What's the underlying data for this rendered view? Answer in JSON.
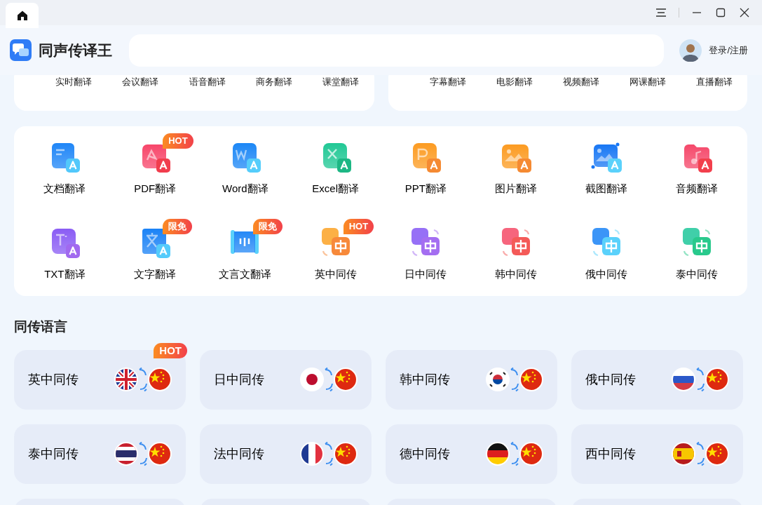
{
  "app": {
    "title": "同声传译王",
    "login": "登录/注册"
  },
  "top_cards": [
    {
      "items": [
        "实时翻译",
        "会议翻译",
        "语音翻译",
        "商务翻译",
        "课堂翻译"
      ]
    },
    {
      "items": [
        "字幕翻译",
        "电影翻译",
        "视频翻译",
        "网课翻译",
        "直播翻译"
      ]
    }
  ],
  "tools": [
    {
      "label": "文档翻译",
      "kind": "doc"
    },
    {
      "label": "PDF翻译",
      "kind": "pdf",
      "badge": "HOT"
    },
    {
      "label": "Word翻译",
      "kind": "word"
    },
    {
      "label": "Excel翻译",
      "kind": "excel"
    },
    {
      "label": "PPT翻译",
      "kind": "ppt"
    },
    {
      "label": "图片翻译",
      "kind": "image"
    },
    {
      "label": "截图翻译",
      "kind": "screenshot"
    },
    {
      "label": "音频翻译",
      "kind": "audio"
    },
    {
      "label": "TXT翻译",
      "kind": "txt"
    },
    {
      "label": "文字翻译",
      "kind": "text",
      "badge": "限免"
    },
    {
      "label": "文言文翻译",
      "kind": "scroll",
      "badge": "限免"
    },
    {
      "label": "英中同传",
      "kind": "pair-orange",
      "badge": "HOT"
    },
    {
      "label": "日中同传",
      "kind": "pair-purple"
    },
    {
      "label": "韩中同传",
      "kind": "pair-red"
    },
    {
      "label": "俄中同传",
      "kind": "pair-blue"
    },
    {
      "label": "泰中同传",
      "kind": "pair-green"
    }
  ],
  "languages": {
    "heading": "同传语言",
    "cards": [
      {
        "label": "英中同传",
        "kind": "uk",
        "badge": "HOT"
      },
      {
        "label": "日中同传",
        "kind": "jp"
      },
      {
        "label": "韩中同传",
        "kind": "kr"
      },
      {
        "label": "俄中同传",
        "kind": "ru"
      },
      {
        "label": "泰中同传",
        "kind": "th"
      },
      {
        "label": "法中同传",
        "kind": "fr"
      },
      {
        "label": "德中同传",
        "kind": "de"
      },
      {
        "label": "西中同传",
        "kind": "es"
      },
      {
        "kind": "cut"
      },
      {
        "kind": "cut"
      },
      {
        "kind": "cut"
      },
      {
        "kind": "cut"
      }
    ]
  }
}
